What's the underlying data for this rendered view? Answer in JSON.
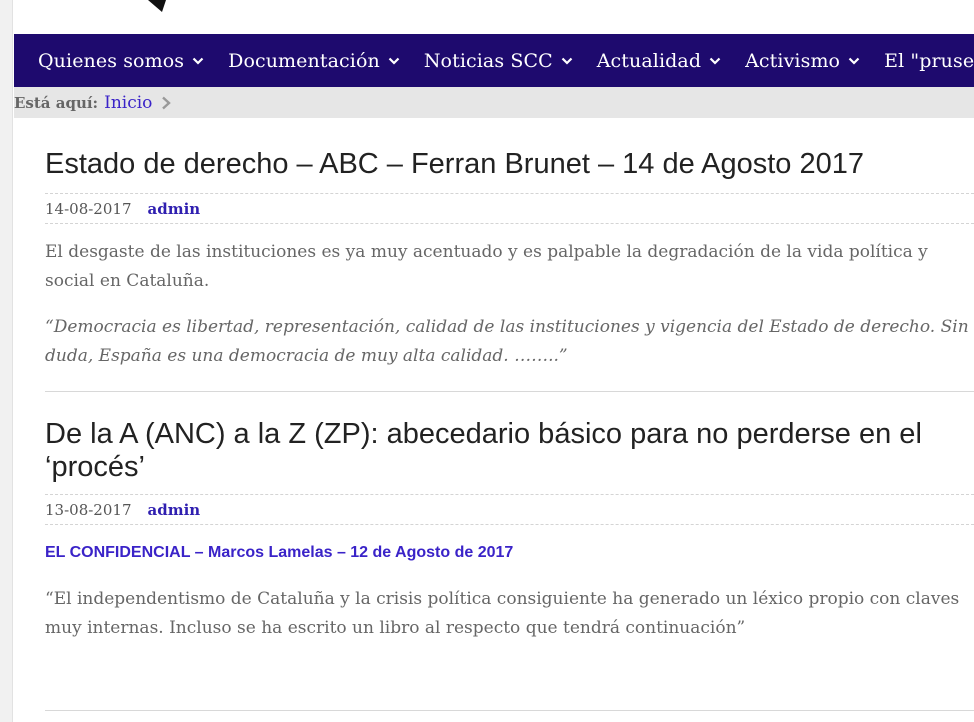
{
  "nav": {
    "items": [
      {
        "label": "Quienes somos"
      },
      {
        "label": "Documentación"
      },
      {
        "label": "Noticias SCC"
      },
      {
        "label": "Actualidad"
      },
      {
        "label": "Activismo"
      },
      {
        "label": "El \"pruses"
      }
    ]
  },
  "breadcrumb": {
    "label": "Está aquí:",
    "home": "Inicio"
  },
  "posts": [
    {
      "title": "Estado de derecho – ABC – Ferran Brunet – 14 de Agosto 2017",
      "date": "14-08-2017",
      "author": "admin",
      "excerpt": "El desgaste de las instituciones es ya muy acentuado y es palpable la degradación de la vida política y social en Cataluña.",
      "quote": "“Democracia es libertad, representación, calidad de las instituciones y vigencia del Estado de derecho. Sin duda, España es una democracia de muy alta calidad. ……..”"
    },
    {
      "title": "De la A (ANC) a la Z (ZP): abecedario básico para no perderse en el ‘procés’",
      "date": "13-08-2017",
      "author": "admin",
      "source_link": "EL CONFIDENCIAL – Marcos Lamelas – 12 de Agosto de 2017",
      "excerpt": "“El independentismo de Cataluña y la crisis política consiguiente ha generado un léxico propio con claves muy internas. Incluso se ha escrito un libro al respecto que tendrá continuación”"
    }
  ],
  "colors": {
    "nav_bg": "#1e0a6e",
    "link": "#3a23c8",
    "breadcrumb_bg": "#e6e6e6"
  }
}
